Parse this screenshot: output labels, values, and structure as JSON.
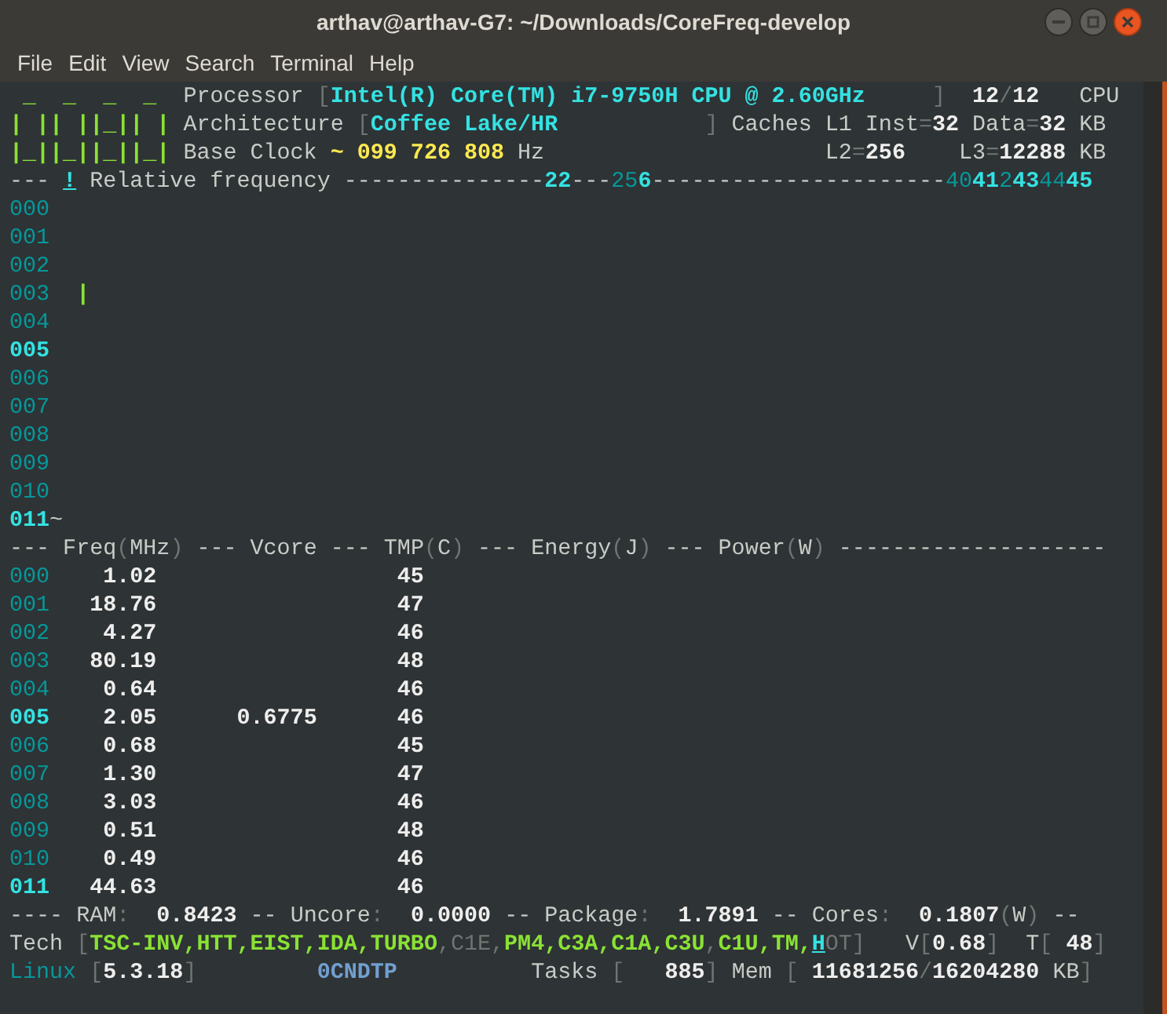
{
  "window": {
    "title": "arthav@arthav-G7: ~/Downloads/CoreFreq-develop"
  },
  "menu": [
    "File",
    "Edit",
    "View",
    "Search",
    "Terminal",
    "Help"
  ],
  "terminal": {
    "lines": [
      {
        "segments": [
          {
            "text": " _  _  _  _  ",
            "kind": "logo"
          },
          {
            "text": "Processor ",
            "kind": "plain"
          },
          {
            "text": "[",
            "kind": "dim"
          },
          {
            "text": "Intel(R) Core(TM) i7-9750H CPU @ 2.60GHz",
            "kind": "cyan"
          },
          {
            "text": "     ]",
            "kind": "dim"
          },
          {
            "text": "  12",
            "kind": "bold"
          },
          {
            "text": "/",
            "kind": "dim"
          },
          {
            "text": "12",
            "kind": "bold"
          },
          {
            "text": "   CPU",
            "kind": "plain"
          }
        ]
      },
      {
        "segments": [
          {
            "text": "| || ||_|| | ",
            "kind": "logo"
          },
          {
            "text": "Architecture ",
            "kind": "plain"
          },
          {
            "text": "[",
            "kind": "dim"
          },
          {
            "text": "Coffee Lake/HR",
            "kind": "cyan"
          },
          {
            "text": "           ]",
            "kind": "dim"
          },
          {
            "text": " Caches L1 Inst",
            "kind": "plain"
          },
          {
            "text": "=",
            "kind": "dim"
          },
          {
            "text": "32",
            "kind": "bold"
          },
          {
            "text": " Data",
            "kind": "plain"
          },
          {
            "text": "=",
            "kind": "dim"
          },
          {
            "text": "32",
            "kind": "bold"
          },
          {
            "text": " KB",
            "kind": "plain"
          }
        ]
      },
      {
        "segments": [
          {
            "text": "|_||_||_||_| ",
            "kind": "logo"
          },
          {
            "text": "Base Clock ",
            "kind": "plain"
          },
          {
            "text": "~ 099 726 808",
            "kind": "yellow"
          },
          {
            "text": " Hz                     L2",
            "kind": "plain"
          },
          {
            "text": "=",
            "kind": "dim"
          },
          {
            "text": "256",
            "kind": "bold"
          },
          {
            "text": "    L3",
            "kind": "plain"
          },
          {
            "text": "=",
            "kind": "dim"
          },
          {
            "text": "12288",
            "kind": "bold"
          },
          {
            "text": " KB",
            "kind": "plain"
          }
        ]
      },
      {
        "segments": [
          {
            "text": "--- ",
            "kind": "plain"
          },
          {
            "text": "!",
            "kind": "link"
          },
          {
            "text": " Relative frequency ---------------",
            "kind": "plain"
          },
          {
            "text": "22",
            "kind": "cyan"
          },
          {
            "text": "---",
            "kind": "plain"
          },
          {
            "text": "25",
            "kind": "teal"
          },
          {
            "text": "6",
            "kind": "cyan"
          },
          {
            "text": "----------------------",
            "kind": "plain"
          },
          {
            "text": "40",
            "kind": "teal"
          },
          {
            "text": "41",
            "kind": "cyan"
          },
          {
            "text": "2",
            "kind": "teal"
          },
          {
            "text": "43",
            "kind": "cyan"
          },
          {
            "text": "44",
            "kind": "teal"
          },
          {
            "text": "45",
            "kind": "cyan"
          }
        ]
      },
      {
        "segments": [
          {
            "text": "000",
            "kind": "teal"
          }
        ]
      },
      {
        "segments": [
          {
            "text": "001",
            "kind": "teal"
          }
        ]
      },
      {
        "segments": [
          {
            "text": "002",
            "kind": "teal"
          }
        ]
      },
      {
        "segments": [
          {
            "text": "003",
            "kind": "teal"
          },
          {
            "text": "  |",
            "kind": "bar"
          }
        ]
      },
      {
        "segments": [
          {
            "text": "004",
            "kind": "teal"
          }
        ]
      },
      {
        "segments": [
          {
            "text": "005",
            "kind": "cyan"
          }
        ]
      },
      {
        "segments": [
          {
            "text": "006",
            "kind": "teal"
          }
        ]
      },
      {
        "segments": [
          {
            "text": "007",
            "kind": "teal"
          }
        ]
      },
      {
        "segments": [
          {
            "text": "008",
            "kind": "teal"
          }
        ]
      },
      {
        "segments": [
          {
            "text": "009",
            "kind": "teal"
          }
        ]
      },
      {
        "segments": [
          {
            "text": "010",
            "kind": "teal"
          }
        ]
      },
      {
        "segments": [
          {
            "text": "011",
            "kind": "cyan"
          },
          {
            "text": "~",
            "kind": "plain"
          }
        ]
      },
      {
        "segments": [
          {
            "text": "--- Freq",
            "kind": "plain"
          },
          {
            "text": "(",
            "kind": "dim"
          },
          {
            "text": "MHz",
            "kind": "plain"
          },
          {
            "text": ")",
            "kind": "dim"
          },
          {
            "text": " --- Vcore --- TMP",
            "kind": "plain"
          },
          {
            "text": "(",
            "kind": "dim"
          },
          {
            "text": "C",
            "kind": "plain"
          },
          {
            "text": ")",
            "kind": "dim"
          },
          {
            "text": " --- Energy",
            "kind": "plain"
          },
          {
            "text": "(",
            "kind": "dim"
          },
          {
            "text": "J",
            "kind": "plain"
          },
          {
            "text": ")",
            "kind": "dim"
          },
          {
            "text": " --- Power",
            "kind": "plain"
          },
          {
            "text": "(",
            "kind": "dim"
          },
          {
            "text": "W",
            "kind": "plain"
          },
          {
            "text": ")",
            "kind": "dim"
          },
          {
            "text": " --------------------",
            "kind": "plain"
          }
        ]
      },
      {
        "segments": [
          {
            "text": "000",
            "kind": "teal"
          },
          {
            "text": "    1.02                  45",
            "kind": "bold"
          }
        ]
      },
      {
        "segments": [
          {
            "text": "001",
            "kind": "teal"
          },
          {
            "text": "   18.76                  47",
            "kind": "bold"
          }
        ]
      },
      {
        "segments": [
          {
            "text": "002",
            "kind": "teal"
          },
          {
            "text": "    4.27                  46",
            "kind": "bold"
          }
        ]
      },
      {
        "segments": [
          {
            "text": "003",
            "kind": "teal"
          },
          {
            "text": "   80.19                  48",
            "kind": "bold"
          }
        ]
      },
      {
        "segments": [
          {
            "text": "004",
            "kind": "teal"
          },
          {
            "text": "    0.64                  46",
            "kind": "bold"
          }
        ]
      },
      {
        "segments": [
          {
            "text": "005",
            "kind": "cyan"
          },
          {
            "text": "    2.05      0.6775      46",
            "kind": "bold"
          }
        ]
      },
      {
        "segments": [
          {
            "text": "006",
            "kind": "teal"
          },
          {
            "text": "    0.68                  45",
            "kind": "bold"
          }
        ]
      },
      {
        "segments": [
          {
            "text": "007",
            "kind": "teal"
          },
          {
            "text": "    1.30                  47",
            "kind": "bold"
          }
        ]
      },
      {
        "segments": [
          {
            "text": "008",
            "kind": "teal"
          },
          {
            "text": "    3.03                  46",
            "kind": "bold"
          }
        ]
      },
      {
        "segments": [
          {
            "text": "009",
            "kind": "teal"
          },
          {
            "text": "    0.51                  48",
            "kind": "bold"
          }
        ]
      },
      {
        "segments": [
          {
            "text": "010",
            "kind": "teal"
          },
          {
            "text": "    0.49                  46",
            "kind": "bold"
          }
        ]
      },
      {
        "segments": [
          {
            "text": "011",
            "kind": "cyan"
          },
          {
            "text": "   44.63                  46",
            "kind": "bold"
          }
        ]
      },
      {
        "segments": [
          {
            "text": "---- RAM",
            "kind": "plain"
          },
          {
            "text": ":",
            "kind": "dim"
          },
          {
            "text": "  0.8423",
            "kind": "bold"
          },
          {
            "text": " -- Uncore",
            "kind": "plain"
          },
          {
            "text": ":",
            "kind": "dim"
          },
          {
            "text": "  0.0000",
            "kind": "bold"
          },
          {
            "text": " -- Package",
            "kind": "plain"
          },
          {
            "text": ":",
            "kind": "dim"
          },
          {
            "text": "  1.7891",
            "kind": "bold"
          },
          {
            "text": " -- Cores",
            "kind": "plain"
          },
          {
            "text": ":",
            "kind": "dim"
          },
          {
            "text": "  0.1807",
            "kind": "bold"
          },
          {
            "text": "(",
            "kind": "dim"
          },
          {
            "text": "W",
            "kind": "plain"
          },
          {
            "text": ")",
            "kind": "dim"
          },
          {
            "text": " --",
            "kind": "plain"
          }
        ]
      },
      {
        "segments": [
          {
            "text": "Tech ",
            "kind": "plain"
          },
          {
            "text": "[",
            "kind": "dim"
          },
          {
            "text": "TSC-INV,HTT,EIST,IDA,TURBO",
            "kind": "feature"
          },
          {
            "text": ",C1E,",
            "kind": "dim"
          },
          {
            "text": "PM4,C3A,C1A,C3U",
            "kind": "feature"
          },
          {
            "text": ",",
            "kind": "dim"
          },
          {
            "text": "C1U,TM,",
            "kind": "feature"
          },
          {
            "text": "H",
            "kind": "link"
          },
          {
            "text": "OT]",
            "kind": "dim"
          },
          {
            "text": "   V",
            "kind": "plain"
          },
          {
            "text": "[",
            "kind": "dim"
          },
          {
            "text": "0.68",
            "kind": "bold"
          },
          {
            "text": "]",
            "kind": "dim"
          },
          {
            "text": "  T",
            "kind": "plain"
          },
          {
            "text": "[",
            "kind": "dim"
          },
          {
            "text": " 48",
            "kind": "bold"
          },
          {
            "text": "]",
            "kind": "dim"
          }
        ]
      },
      {
        "segments": [
          {
            "text": "Linux ",
            "kind": "teal"
          },
          {
            "text": "[",
            "kind": "dim"
          },
          {
            "text": "5.3.18",
            "kind": "bold"
          },
          {
            "text": "]",
            "kind": "dim"
          },
          {
            "text": "         0CNDTP",
            "kind": "blue"
          },
          {
            "text": "          Tasks ",
            "kind": "plain"
          },
          {
            "text": "[",
            "kind": "dim"
          },
          {
            "text": "   885",
            "kind": "bold"
          },
          {
            "text": "]",
            "kind": "dim"
          },
          {
            "text": " Mem ",
            "kind": "plain"
          },
          {
            "text": "[",
            "kind": "dim"
          },
          {
            "text": " 11681256",
            "kind": "bold"
          },
          {
            "text": "/",
            "kind": "dim"
          },
          {
            "text": "16204280",
            "kind": "bold"
          },
          {
            "text": " KB",
            "kind": "plain"
          },
          {
            "text": "]",
            "kind": "dim"
          }
        ]
      }
    ]
  }
}
